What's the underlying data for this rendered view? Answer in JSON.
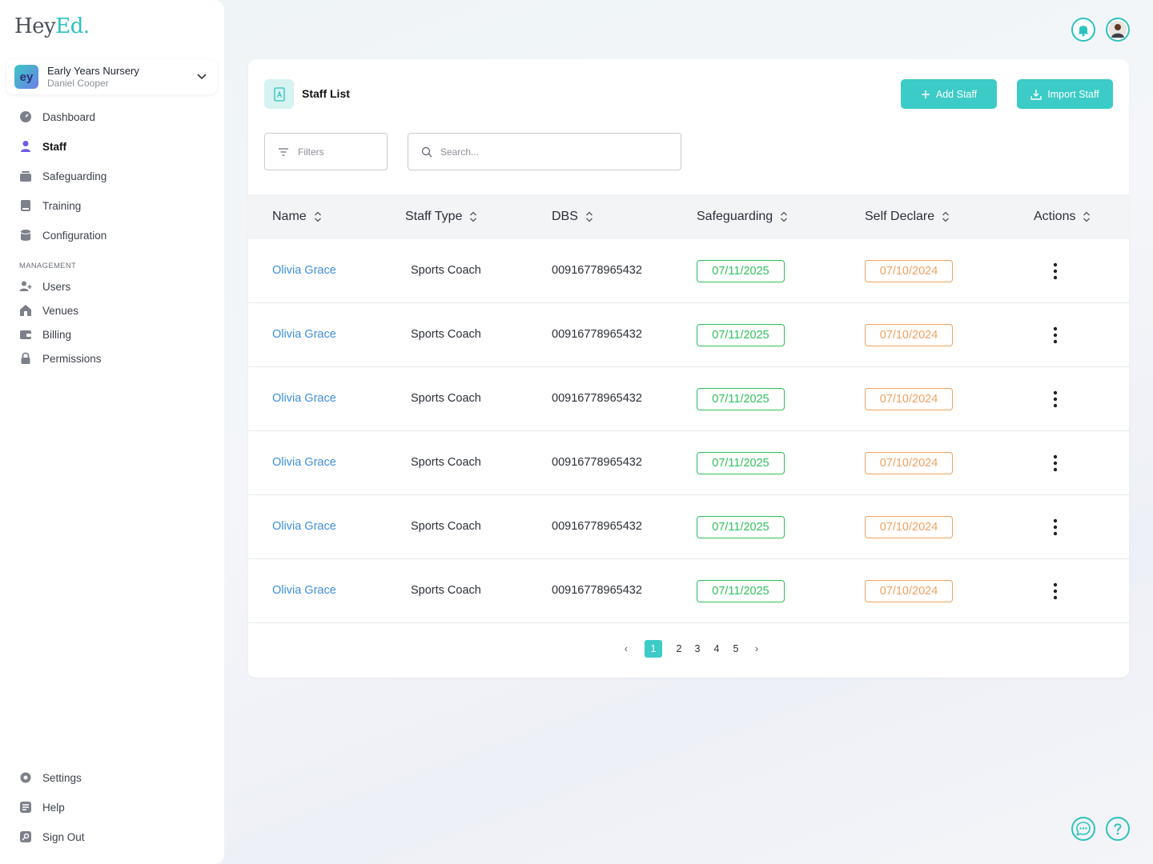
{
  "brand": {
    "logo_main": "Hey",
    "logo_accent": "Ed."
  },
  "org": {
    "avatar": "ey",
    "name": "Early Years Nursery",
    "user": "Daniel Cooper"
  },
  "nav": {
    "dashboard": "Dashboard",
    "staff": "Staff",
    "safeguarding": "Safeguarding",
    "training": "Training",
    "configuration": "Configuration",
    "section_management": "MANAGEMENT",
    "users": "Users",
    "venues": "Venues",
    "billing": "Billing",
    "permissions": "Permissions",
    "settings": "Settings",
    "help": "Help",
    "sign_out": "Sign Out"
  },
  "card": {
    "title": "Staff List",
    "add_label": "Add Staff",
    "import_label": "Import Staff",
    "filters_label": "Filters",
    "search_placeholder": "Search..."
  },
  "table": {
    "headers": [
      "Name",
      "Staff Type",
      "DBS",
      "Safeguarding",
      "Self Declare",
      "Actions"
    ],
    "rows": [
      {
        "name": "Olivia Grace",
        "type": "Sports Coach",
        "dbs": "00916778965432",
        "safeguarding": "07/11/2025",
        "self_declare": "07/10/2024"
      },
      {
        "name": "Olivia Grace",
        "type": "Sports Coach",
        "dbs": "00916778965432",
        "safeguarding": "07/11/2025",
        "self_declare": "07/10/2024"
      },
      {
        "name": "Olivia Grace",
        "type": "Sports Coach",
        "dbs": "00916778965432",
        "safeguarding": "07/11/2025",
        "self_declare": "07/10/2024"
      },
      {
        "name": "Olivia Grace",
        "type": "Sports Coach",
        "dbs": "00916778965432",
        "safeguarding": "07/11/2025",
        "self_declare": "07/10/2024"
      },
      {
        "name": "Olivia Grace",
        "type": "Sports Coach",
        "dbs": "00916778965432",
        "safeguarding": "07/11/2025",
        "self_declare": "07/10/2024"
      },
      {
        "name": "Olivia Grace",
        "type": "Sports Coach",
        "dbs": "00916778965432",
        "safeguarding": "07/11/2025",
        "self_declare": "07/10/2024"
      }
    ]
  },
  "pagination": {
    "prev": "‹",
    "next": "›",
    "pages": [
      "1",
      "2",
      "3",
      "4",
      "5"
    ],
    "current": "1"
  },
  "colors": {
    "accent": "#3ccbc6",
    "link": "#3d8fdc",
    "valid": "#2fbf5a",
    "warning": "#f2a15f",
    "active_nav_icon": "#6c5ce7"
  }
}
